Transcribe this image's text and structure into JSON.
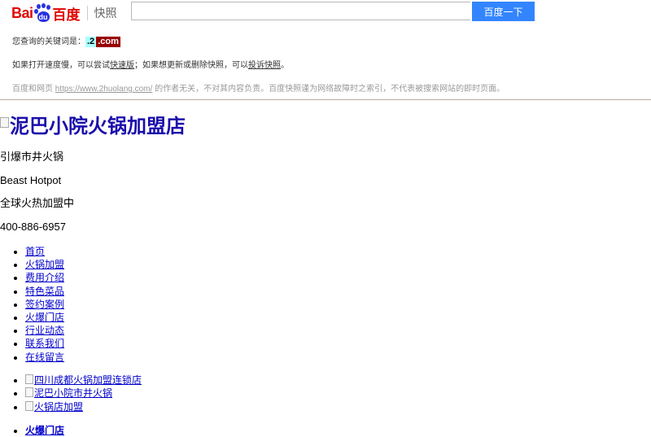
{
  "header": {
    "logo": {
      "bai": "Bai",
      "du": "du",
      "cn": "百度",
      "section": "快照"
    },
    "search": {
      "value": "",
      "placeholder": ""
    },
    "search_button": "百度一下",
    "keyword_label": "您查询的关键词是：",
    "keywords": [
      ".2",
      ".com"
    ],
    "tip": {
      "prefix": "如果打开速度慢，可以尝试",
      "fast_link": "快速版",
      "middle": "；如果想更新或删除快照，可以",
      "complaint_link": "投诉快照",
      "suffix": "。"
    },
    "disclaimer": {
      "prefix": "百度和网页 ",
      "url": "https://www.2huolang.com/",
      "suffix": " 的作者无关，不对其内容负责。百度快照谨为网络故障时之索引，不代表被搜索网站的即时页面。"
    }
  },
  "page": {
    "logo_alt": "泥巴小院火锅加盟店",
    "lines": [
      "引爆市井火锅",
      "Beast Hotpot",
      "全球火热加盟中",
      "400-886-6957"
    ],
    "nav": [
      "首页",
      "火锅加盟",
      "费用介绍",
      "特色菜品",
      "签约案例",
      "火爆门店",
      "行业动态",
      "联系我们",
      "在线留言"
    ],
    "slides": [
      "四川成都火锅加盟连锁店",
      "泥巴小院市井火锅",
      "火锅店加盟"
    ],
    "categories": [
      "火爆门店"
    ]
  },
  "colors": {
    "accent": "#3385ff",
    "brand_red": "#e10602",
    "brand_blue": "#2932e1",
    "link": "#0000cc"
  }
}
